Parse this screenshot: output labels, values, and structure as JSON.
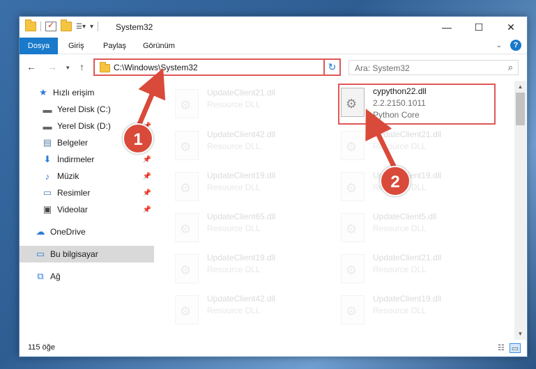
{
  "window": {
    "title": "System32",
    "controls": {
      "minimize": "—",
      "maximize": "☐",
      "close": "✕"
    }
  },
  "ribbon": {
    "tabs": [
      "Dosya",
      "Giriş",
      "Paylaş",
      "Görünüm"
    ],
    "accent": "#1979ca"
  },
  "nav": {
    "address": "C:\\Windows\\System32",
    "search_placeholder": "Ara: System32"
  },
  "sidebar": {
    "items": [
      {
        "label": "Hızlı erişim",
        "icon": "star-icon",
        "glyph": "★"
      },
      {
        "label": "Yerel Disk (C:)",
        "icon": "drive-icon",
        "glyph": "▬"
      },
      {
        "label": "Yerel Disk (D:)",
        "icon": "drive-icon",
        "glyph": "▬"
      },
      {
        "label": "Belgeler",
        "icon": "documents-icon",
        "glyph": "▤"
      },
      {
        "label": "İndirmeler",
        "icon": "downloads-icon",
        "glyph": "⬇"
      },
      {
        "label": "Müzik",
        "icon": "music-icon",
        "glyph": "♪"
      },
      {
        "label": "Resimler",
        "icon": "pictures-icon",
        "glyph": "▭"
      },
      {
        "label": "Videolar",
        "icon": "videos-icon",
        "glyph": "▣"
      },
      {
        "label": "OneDrive",
        "icon": "onedrive-icon",
        "glyph": "☁"
      },
      {
        "label": "Bu bilgisayar",
        "icon": "this-pc-icon",
        "glyph": "▭"
      },
      {
        "label": "Ağ",
        "icon": "network-icon",
        "glyph": "⧉"
      }
    ]
  },
  "files": {
    "left": [
      {
        "name": "UpdateClient21.dll",
        "type": "Resource DLL"
      },
      {
        "name": "UpdateClient42.dll",
        "type": "Resource DLL"
      },
      {
        "name": "UpdateClient19.dll",
        "type": "Resource DLL"
      },
      {
        "name": "UpdateClient65.dll",
        "type": "Resource DLL"
      },
      {
        "name": "UpdateClient19.dll",
        "type": "Resource DLL"
      },
      {
        "name": "UpdateClient42.dll",
        "type": "Resource DLL"
      }
    ],
    "right": [
      {
        "name": "UpdateClient21.dll",
        "type": "Resource DLL"
      },
      {
        "name": "UpdateClient19.dll",
        "type": "Resource DLL"
      },
      {
        "name": "UpdateClient5.dll",
        "type": "Resource DLL"
      },
      {
        "name": "UpdateClient21.dll",
        "type": "Resource DLL"
      },
      {
        "name": "UpdateClient19.dll",
        "type": "Resource DLL"
      }
    ],
    "highlighted": {
      "name": "cypython22.dll",
      "version": "2.2.2150.1011",
      "description": "Python Core"
    }
  },
  "status": {
    "count": "115 öğe"
  },
  "annotations": {
    "step1": "1",
    "step2": "2",
    "color": "#d94a3a"
  }
}
